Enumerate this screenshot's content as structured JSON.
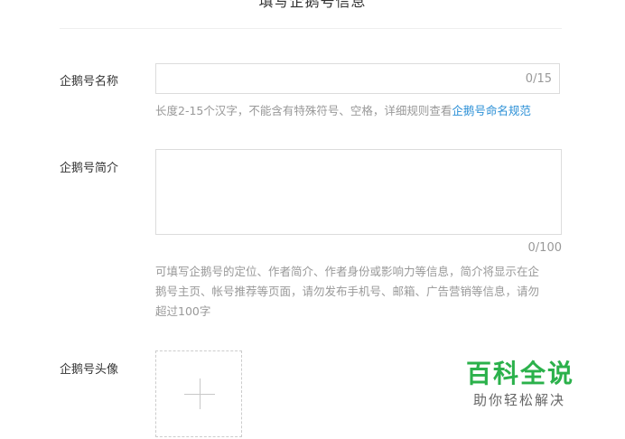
{
  "section": {
    "title": "填写企鹅号信息"
  },
  "name_field": {
    "label": "企鹅号名称",
    "counter": "0/15",
    "help_prefix": "长度2-15个汉字，不能含有特殊符号、空格，详细规则查看",
    "help_link": "企鹅号命名规范"
  },
  "intro_field": {
    "label": "企鹅号简介",
    "counter": "0/100",
    "help_line1": "可填写企鹅号的定位、作者简介、作者身份或影响力等信息，简介将显示在企",
    "help_line2": "鹅号主页、帐号推荐等页面，请勿发布手机号、邮箱、广告营销等信息，请勿",
    "help_line3": "超过100字"
  },
  "avatar_field": {
    "label": "企鹅号头像",
    "upload_icon": "plus-icon"
  },
  "watermark": {
    "main": "百科全说",
    "sub": "助你轻松解决"
  },
  "colors": {
    "link": "#2a8fd6",
    "watermark_green": "#2bb14b",
    "border": "#dcdcdc"
  }
}
